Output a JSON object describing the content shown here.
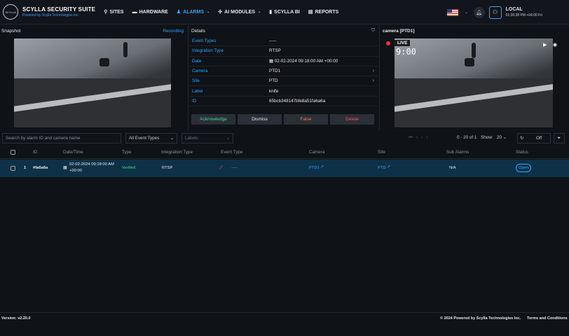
{
  "app": {
    "name": "SCYLLA SECURITY SUITE",
    "tagline": "Powered by Scylla Technologies Inc.",
    "logo_text": "SCYLLA"
  },
  "nav": {
    "items": [
      {
        "label": "SITES",
        "icon": "pin-icon"
      },
      {
        "label": "HARDWARE",
        "icon": "car-icon"
      },
      {
        "label": "ALARMS",
        "icon": "bell-icon"
      },
      {
        "label": "AI MODULES",
        "icon": "brain-icon"
      },
      {
        "label": "SCYLLA BI",
        "icon": "chart-icon"
      },
      {
        "label": "REPORTS",
        "icon": "report-icon"
      }
    ]
  },
  "user": {
    "name": "LOCAL",
    "time": "01:36:38 PM +04:00 Fri"
  },
  "snapshot": {
    "title": "Snapshot",
    "recording_label": "Recording"
  },
  "details": {
    "title": "Details",
    "rows": [
      {
        "key": "Event Types",
        "value": "-----"
      },
      {
        "key": "Integration Type",
        "value": "RTSP"
      },
      {
        "key": "Date",
        "value": "02-02-2024 09:18:00 AM +00:00"
      },
      {
        "key": "Camera",
        "value": "PTD1"
      },
      {
        "key": "Site",
        "value": "PTD"
      },
      {
        "key": "Label",
        "value": "knife"
      },
      {
        "key": "ID",
        "value": "65bcb348147bfe8a51fa6a6a"
      }
    ],
    "buttons": {
      "acknowledge": "Acknowledge",
      "dismiss": "Dismiss",
      "false": "False",
      "delete": "Delete"
    }
  },
  "camera": {
    "title": "camera [PTD1]",
    "live_label": "LIVE",
    "clock": "9:00"
  },
  "filters": {
    "search_placeholder": "Search by alarm ID and camera name",
    "event_types": "All Event Types",
    "labels": "Labels",
    "range": "0 - 20 of 1",
    "show_label": "Show:",
    "show_value": "20",
    "refresh_toggle": "Off"
  },
  "table": {
    "headers": [
      "ID",
      "Date/Time",
      "Type",
      "Integration Type",
      "Event Type",
      "Camera",
      "Site",
      "Sub Alarms",
      "Status"
    ],
    "rows": [
      {
        "index": "1",
        "id": "#fa6a6a",
        "date_line1": "02-02-2024 09:18:00 AM",
        "date_line2": "+00:00",
        "type": "Verified",
        "integration": "RTSP",
        "event_type": "-----",
        "camera": "PTD1",
        "site": "PTD",
        "sub_alarms": "N/A",
        "status": "Open"
      }
    ]
  },
  "footer": {
    "version": "Version: v2.20.0",
    "copyright": "© 2024 Powered by Scylla Technologies Inc.",
    "terms": "Terms and Conditions"
  },
  "colors": {
    "accent": "#2aa7ff",
    "verified": "#3ddc84",
    "false": "#ff7a3c",
    "delete": "#ff4d5e",
    "live": "#ff2a3a"
  }
}
